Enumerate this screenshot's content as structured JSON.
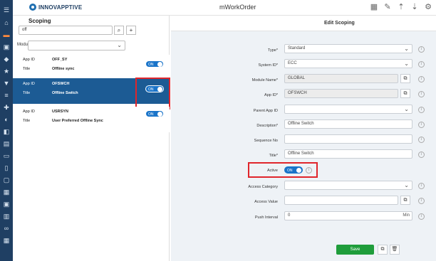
{
  "header": {
    "logo_text": "INNOVAPPTIVE",
    "app_title": "mWorkOrder",
    "icons": [
      "grid-icon",
      "edit-icon",
      "upload-icon",
      "download-icon",
      "gear-icon"
    ]
  },
  "rail_icons": [
    "menu-icon",
    "home-icon",
    "card-icon",
    "window-icon",
    "tag-icon",
    "star-icon",
    "filter-icon",
    "list-icon",
    "tools-icon",
    "dashboard-icon",
    "layers-icon",
    "window-icon",
    "folder-icon",
    "document-icon",
    "monitor-icon",
    "calendar-icon",
    "monitor-icon",
    "printer-icon",
    "link-icon",
    "table-icon"
  ],
  "left": {
    "title": "Scoping",
    "search": {
      "value": "off"
    },
    "module": {
      "label": "Module",
      "value": ""
    },
    "items": [
      {
        "k1": "App ID",
        "v1": "OFF_SY",
        "k2": "Title",
        "v2": "Offline sync",
        "toggle": "ON",
        "selected": false
      },
      {
        "k1": "App ID",
        "v1": "OFSWCH",
        "k2": "Title",
        "v2": "Offline Switch",
        "toggle": "ON",
        "selected": true
      },
      {
        "k1": "App ID",
        "v1": "USRSYN",
        "k2": "Title",
        "v2": "User Preferred Offline Sync",
        "toggle": "ON",
        "selected": false
      }
    ]
  },
  "form": {
    "title": "Edit Scoping",
    "fields": [
      {
        "label": "Type*",
        "value": "Standard",
        "kind": "select"
      },
      {
        "label": "System ID*",
        "value": "ECC",
        "kind": "select"
      },
      {
        "label": "Module Name*",
        "value": "GLOBAL",
        "kind": "disabled-copy"
      },
      {
        "label": "App ID*",
        "value": "OFSWCH",
        "kind": "disabled-copy"
      },
      {
        "label": "Parent App ID",
        "value": "",
        "kind": "select"
      },
      {
        "label": "Description*",
        "value": "Offline Switch",
        "kind": "text"
      },
      {
        "label": "Sequence No",
        "value": "",
        "kind": "text"
      },
      {
        "label": "Title*",
        "value": "Offline Switch",
        "kind": "text"
      },
      {
        "label": "Active",
        "value": "ON",
        "kind": "toggle"
      },
      {
        "label": "Access Category",
        "value": "",
        "kind": "select"
      },
      {
        "label": "Access Value",
        "value": "",
        "kind": "copy"
      },
      {
        "label": "Push Interval",
        "value": "0",
        "unit": "Min",
        "kind": "unit"
      }
    ],
    "save_label": "Save"
  },
  "colors": {
    "rail": "#1f3f63",
    "selected_row": "#1c5b94",
    "toggle": "#1a74c9",
    "save": "#1f9d3b",
    "highlight": "#e0252b"
  }
}
